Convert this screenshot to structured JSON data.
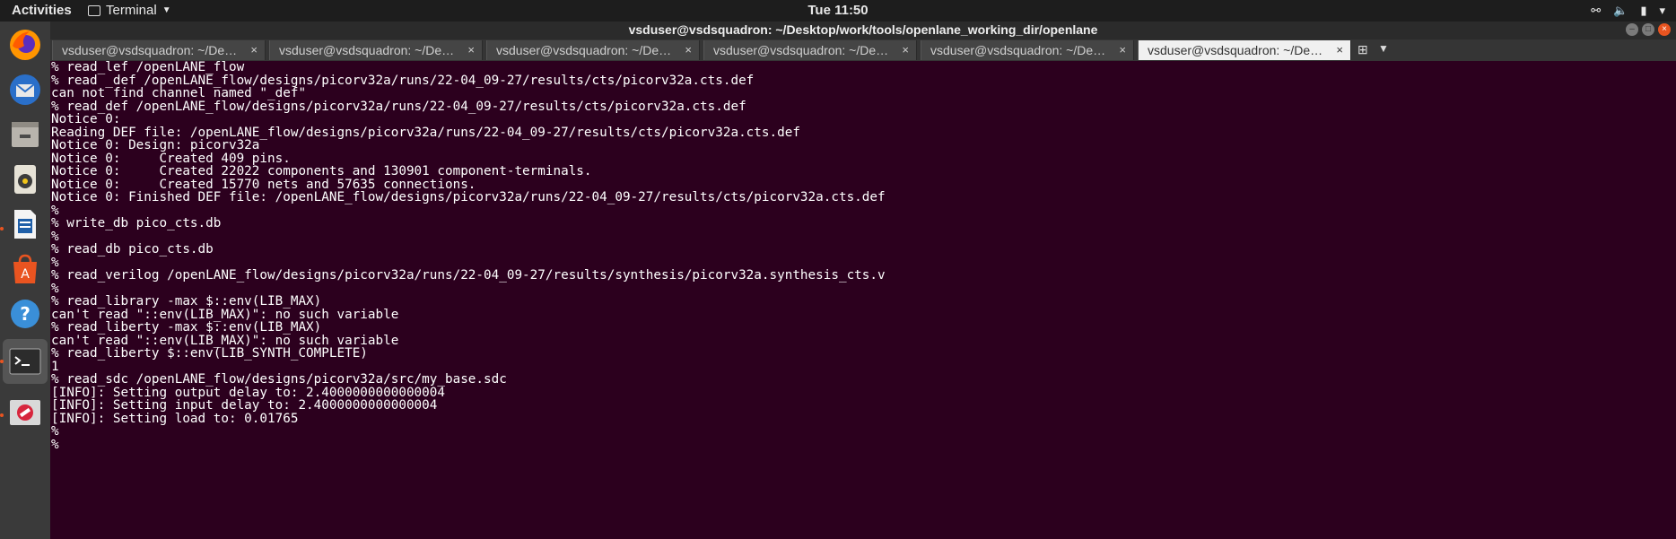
{
  "topbar": {
    "activities": "Activities",
    "app_name": "Terminal",
    "clock": "Tue 11:50"
  },
  "dock": {
    "items": [
      {
        "name": "firefox-icon",
        "running": false
      },
      {
        "name": "thunderbird-icon",
        "running": false
      },
      {
        "name": "files-icon",
        "running": false
      },
      {
        "name": "rhythmbox-icon",
        "running": false
      },
      {
        "name": "libreoffice-writer-icon",
        "running": true
      },
      {
        "name": "software-center-icon",
        "running": false
      },
      {
        "name": "help-icon",
        "running": false
      },
      {
        "name": "terminal-icon",
        "running": true,
        "active": true
      },
      {
        "name": "blocked-app-icon",
        "running": true
      }
    ]
  },
  "window": {
    "title": "vsduser@vsdsquadron: ~/Desktop/work/tools/openlane_working_dir/openlane"
  },
  "tabs": [
    {
      "label": "vsduser@vsdsquadron: ~/Desktop/...",
      "active": false
    },
    {
      "label": "vsduser@vsdsquadron: ~/Desktop/...",
      "active": false
    },
    {
      "label": "vsduser@vsdsquadron: ~/Desktop/...",
      "active": false
    },
    {
      "label": "vsduser@vsdsquadron: ~/Desktop/...",
      "active": false
    },
    {
      "label": "vsduser@vsdsquadron: ~/Desktop/...",
      "active": false
    },
    {
      "label": "vsduser@vsdsquadron: ~/Desktop/...",
      "active": true
    }
  ],
  "terminal": {
    "lines": [
      "% read_lef /openLANE_flow",
      "% read _def /openLANE_flow/designs/picorv32a/runs/22-04_09-27/results/cts/picorv32a.cts.def",
      "can not find channel named \"_def\"",
      "% read_def /openLANE_flow/designs/picorv32a/runs/22-04_09-27/results/cts/picorv32a.cts.def",
      "Notice 0:",
      "Reading DEF file: /openLANE_flow/designs/picorv32a/runs/22-04_09-27/results/cts/picorv32a.cts.def",
      "Notice 0: Design: picorv32a",
      "Notice 0:     Created 409 pins.",
      "Notice 0:     Created 22022 components and 130901 component-terminals.",
      "Notice 0:     Created 15770 nets and 57635 connections.",
      "Notice 0: Finished DEF file: /openLANE_flow/designs/picorv32a/runs/22-04_09-27/results/cts/picorv32a.cts.def",
      "%",
      "% write_db pico_cts.db",
      "%",
      "% read_db pico_cts.db",
      "%",
      "% read_verilog /openLANE_flow/designs/picorv32a/runs/22-04_09-27/results/synthesis/picorv32a.synthesis_cts.v",
      "%",
      "% read_library -max $::env(LIB_MAX)",
      "can't read \"::env(LIB_MAX)\": no such variable",
      "% read_liberty -max $::env(LIB_MAX)",
      "can't read \"::env(LIB_MAX)\": no such variable",
      "% read_liberty $::env(LIB_SYNTH_COMPLETE)",
      "1",
      "% read_sdc /openLANE_flow/designs/picorv32a/src/my_base.sdc",
      "[INFO]: Setting output delay to: 2.4000000000000004",
      "[INFO]: Setting input delay to: 2.4000000000000004",
      "[INFO]: Setting load to: 0.01765",
      "%",
      "%"
    ]
  },
  "colors": {
    "terminal_bg": "#2c001e",
    "accent": "#e95420",
    "topbar_bg": "#1d1d1d"
  }
}
